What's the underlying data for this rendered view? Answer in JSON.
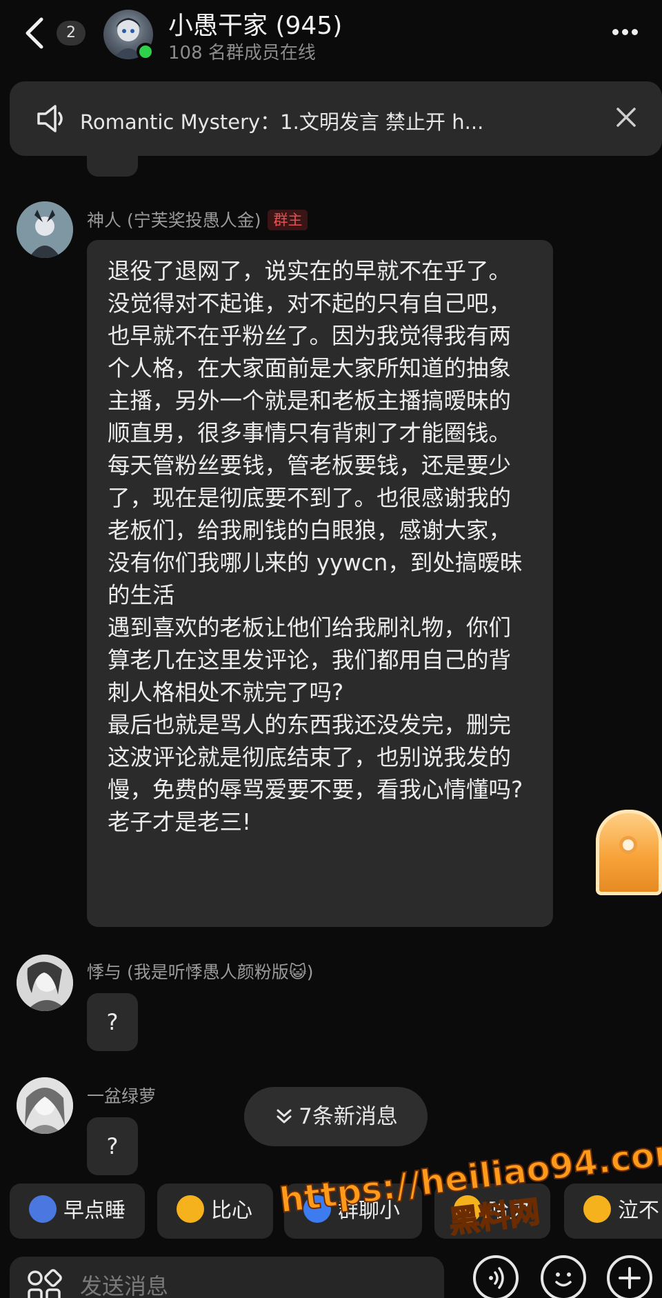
{
  "header": {
    "unread_count": "2",
    "group_title": "小愚干家 (945)",
    "online_members": "108 名群成员在线"
  },
  "announcement": {
    "text": "Romantic Mystery：1.文明发言 禁止开 h..."
  },
  "messages": [
    {
      "sender": "神人 (宁芙奖投愚人金)",
      "badge": "群主",
      "text": "退役了退网了，说实在的早就不在乎了。没觉得对不起谁，对不起的只有自己吧，也早就不在乎粉丝了。因为我觉得我有两个人格，在大家面前是大家所知道的抽象主播，另外一个就是和老板主播搞暧昧的顺直男，很多事情只有背刺了才能圈钱。每天管粉丝要钱，管老板要钱，还是要少了，现在是彻底要不到了。也很感谢我的老板们，给我刷钱的白眼狼，感谢大家，没有你们我哪儿来的 yywcn，到处搞暧昧的生活\n遇到喜欢的老板让他们给我刷礼物，你们算老几在这里发评论，我们都用自己的背刺人格相处不就完了吗?\n最后也就是骂人的东西我还没发完，删完这波评论就是彻底结束了，也别说我发的慢，免费的辱骂爱要不要，看我心情懂吗?老子才是老三!"
    },
    {
      "sender": "悸与 (我是听悸愚人颜粉版😺)",
      "text": "?"
    },
    {
      "sender": "一盆绿萝",
      "text": "?"
    }
  ],
  "new_messages": "7条新消息",
  "quick_replies": [
    {
      "label": "早点睡",
      "icon": "moon-sleep-emoji",
      "color": "#4a78e0"
    },
    {
      "label": "比心",
      "icon": "heart-hand-emoji",
      "color": "#f5b21d"
    },
    {
      "label": "群聊小",
      "icon": "at-mention-emoji",
      "color": "#3d7bf0"
    },
    {
      "label": "哈欠",
      "icon": "yawn-emoji",
      "color": "#f5b21d"
    },
    {
      "label": "泣不",
      "icon": "tear-emoji",
      "color": "#f5b21d"
    }
  ],
  "input": {
    "placeholder": "发送消息"
  },
  "watermark": {
    "url": "https://heiliao94.com",
    "name": "黑料网"
  },
  "colors": {
    "background": "#0b0b0b",
    "bubble": "#2b2b2b",
    "owner_badge": "#e65050",
    "online": "#2fd14a"
  }
}
